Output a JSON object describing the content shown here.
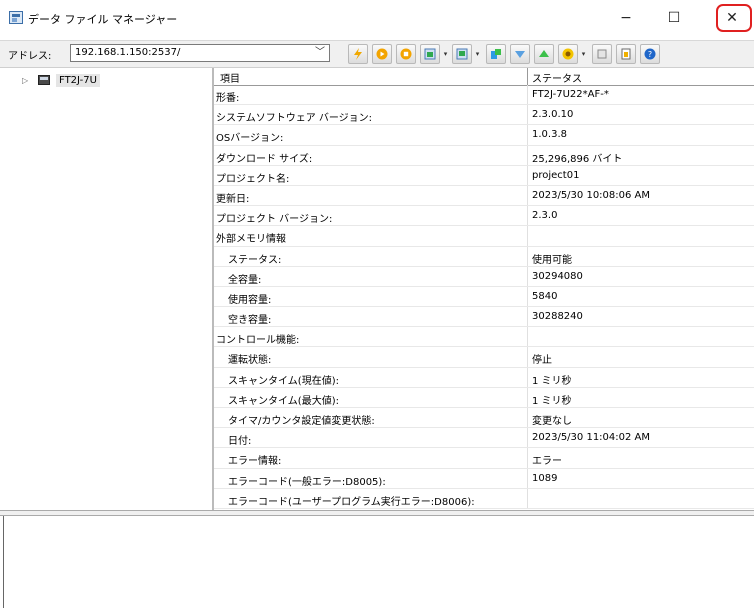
{
  "window": {
    "title": "データ ファイル マネージャー",
    "minimize": "−",
    "maximize": "☐",
    "close": "✕"
  },
  "address": {
    "label": "アドレス:",
    "value": "192.168.1.150:2537/"
  },
  "toolbar": {
    "icons": [
      "lightning-icon",
      "play-icon",
      "stop-icon",
      "download-icon",
      "upload-icon",
      "transfer-icon",
      "arrow-down-icon",
      "arrow-up-icon",
      "target-icon",
      "eraser-icon",
      "document-icon",
      "help-icon"
    ]
  },
  "tree": {
    "expander": "▷",
    "node_label": "FT2J-7U"
  },
  "grid": {
    "headers": [
      "項目",
      "ステータス"
    ],
    "rows": [
      {
        "key": "形番:",
        "value": "FT2J-7U22*AF-*",
        "indent": false
      },
      {
        "key": "システムソフトウェア バージョン:",
        "value": "2.3.0.10",
        "indent": false
      },
      {
        "key": "OSバージョン:",
        "value": "1.0.3.8",
        "indent": false
      },
      {
        "key": "ダウンロード サイズ:",
        "value": "25,296,896 バイト",
        "indent": false
      },
      {
        "key": "プロジェクト名:",
        "value": "project01",
        "indent": false
      },
      {
        "key": "更新日:",
        "value": "2023/5/30 10:08:06 AM",
        "indent": false
      },
      {
        "key": "プロジェクト バージョン:",
        "value": "2.3.0",
        "indent": false
      },
      {
        "key": "外部メモリ情報",
        "value": "",
        "indent": false
      },
      {
        "key": "ステータス:",
        "value": "使用可能",
        "indent": true
      },
      {
        "key": "全容量:",
        "value": "30294080",
        "indent": true
      },
      {
        "key": "使用容量:",
        "value": "5840",
        "indent": true
      },
      {
        "key": "空き容量:",
        "value": "30288240",
        "indent": true
      },
      {
        "key": "コントロール機能:",
        "value": "",
        "indent": false
      },
      {
        "key": "運転状態:",
        "value": "停止",
        "indent": true
      },
      {
        "key": "スキャンタイム(現在値):",
        "value": "1 ミリ秒",
        "indent": true
      },
      {
        "key": "スキャンタイム(最大値):",
        "value": "1 ミリ秒",
        "indent": true
      },
      {
        "key": "タイマ/カウンタ設定値変更状態:",
        "value": "変更なし",
        "indent": true
      },
      {
        "key": "日付:",
        "value": "2023/5/30 11:04:02 AM",
        "indent": true
      },
      {
        "key": "エラー情報:",
        "value": "エラー",
        "indent": true
      },
      {
        "key": "エラーコード(一般エラー:D8005):",
        "value": "1089",
        "indent": true
      },
      {
        "key": "エラーコード(ユーザープログラム実行エラー:D8006):",
        "value": "",
        "indent": true
      }
    ]
  },
  "colors": {
    "close_highlight": "#e02020",
    "selection": "#e5e5e5"
  }
}
